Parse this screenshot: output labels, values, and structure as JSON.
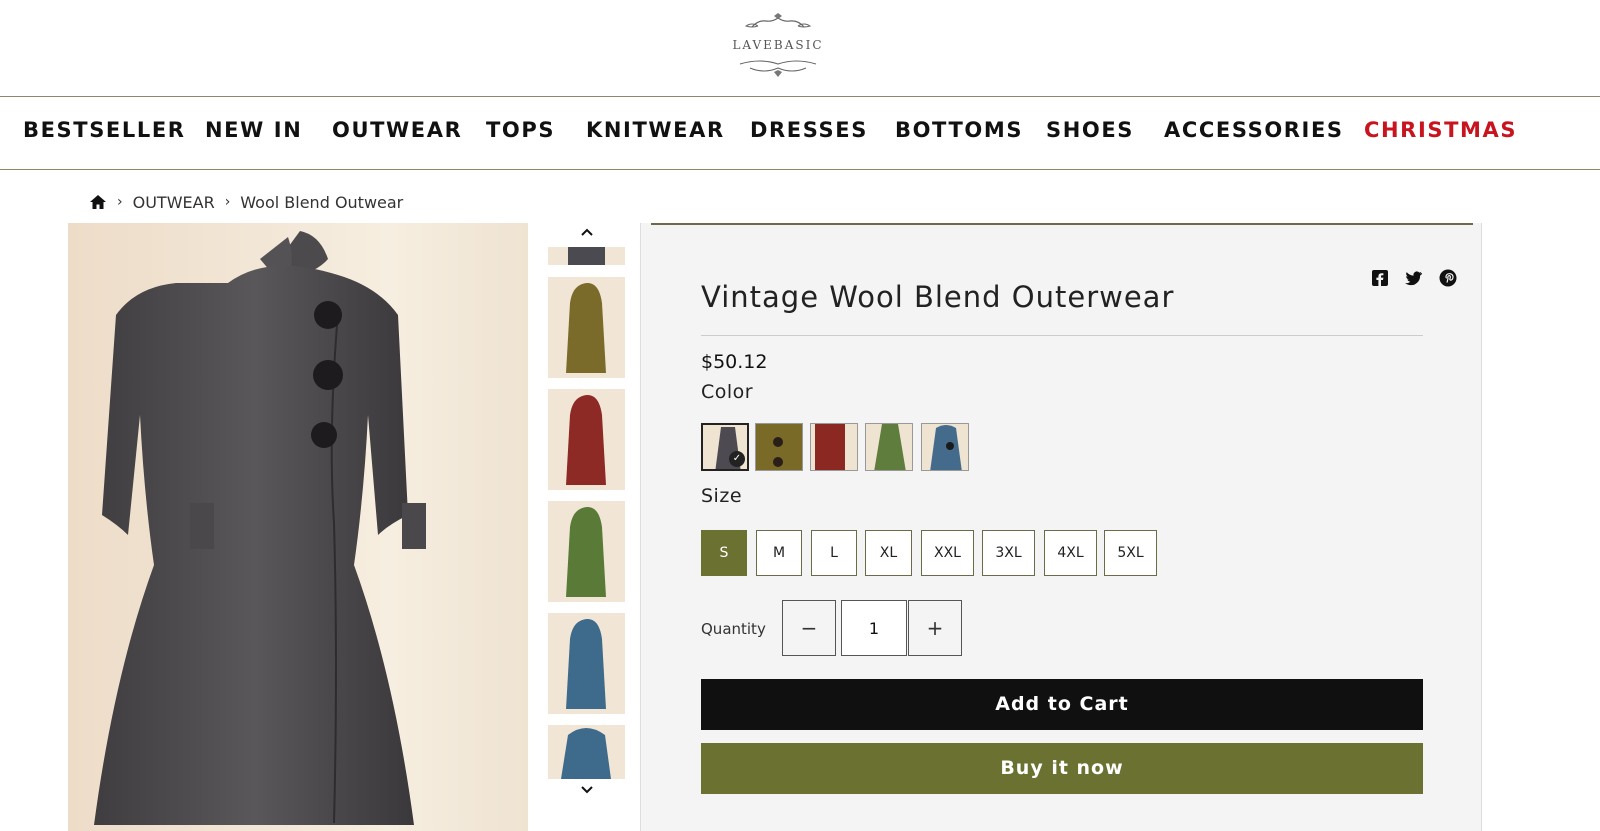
{
  "brand": {
    "name": "LAVEBASIC"
  },
  "nav": {
    "items": [
      {
        "label": "BESTSELLER"
      },
      {
        "label": "NEW IN"
      },
      {
        "label": "OUTWEAR"
      },
      {
        "label": "TOPS"
      },
      {
        "label": "KNITWEAR"
      },
      {
        "label": "DRESSES"
      },
      {
        "label": "BOTTOMS"
      },
      {
        "label": "SHOES"
      },
      {
        "label": "ACCESSORIES"
      },
      {
        "label": "CHRISTMAS",
        "color": "#c8141e"
      }
    ]
  },
  "breadcrumb": {
    "home_icon": "home-icon",
    "items": [
      "OUTWEAR",
      "Wool Blend Outwear"
    ],
    "separator": "›"
  },
  "gallery": {
    "thumbs": [
      {
        "color": "#4a4a50",
        "name": "grey"
      },
      {
        "color": "#7a6b2a",
        "name": "olive"
      },
      {
        "color": "#8e2a26",
        "name": "red"
      },
      {
        "color": "#5a7a38",
        "name": "green"
      },
      {
        "color": "#3e6a8c",
        "name": "blue"
      },
      {
        "color": "#3e6a8c",
        "name": "blue"
      }
    ],
    "up_icon": "chevron-up-icon",
    "down_icon": "chevron-down-icon"
  },
  "product": {
    "title": "Vintage Wool Blend Outerwear",
    "price": "$50.12",
    "color_label": "Color",
    "colors": [
      {
        "hex": "#4d4a52",
        "selected": true
      },
      {
        "hex": "#7a6a28"
      },
      {
        "hex": "#8c2822"
      },
      {
        "hex": "#5f7d3c"
      },
      {
        "hex": "#456b8c"
      }
    ],
    "size_label": "Size",
    "sizes": [
      "S",
      "M",
      "L",
      "XL",
      "XXL",
      "3XL",
      "4XL",
      "5XL"
    ],
    "selected_size": "S",
    "quantity_label": "Quantity",
    "quantity": "1",
    "minus": "−",
    "plus": "+",
    "add_to_cart": "Add to Cart",
    "buy_now": "Buy it now",
    "share": [
      "facebook-icon",
      "twitter-icon",
      "pinterest-icon"
    ]
  },
  "colors": {
    "accent": "#6b7130",
    "dark": "#101010",
    "highlight": "#c8141e"
  }
}
